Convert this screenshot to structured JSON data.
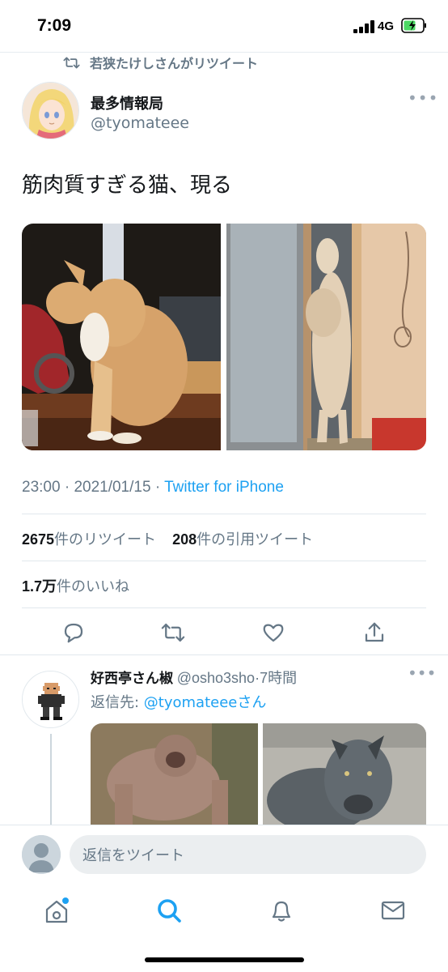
{
  "status_bar": {
    "time": "7:09",
    "network": "4G"
  },
  "retweet_context": {
    "text": "若狭たけしさんがリツイート",
    "icon": "retweet-icon"
  },
  "tweet": {
    "author_name": "最多情報局",
    "author_handle": "@tyomateee",
    "text": "筋肉質すぎる猫、現る",
    "time": "23:00",
    "date": "2021/01/15",
    "client": "Twitter for iPhone",
    "retweets_count": "2675",
    "retweets_label": "件のリツイート",
    "quotes_count": "208",
    "quotes_label": "件の引用ツイート",
    "likes_count": "1.7万",
    "likes_label": "件のいいね"
  },
  "actions": [
    "reply-icon",
    "retweet-icon",
    "like-icon",
    "share-icon"
  ],
  "reply": {
    "author_name": "好西亭さん椒",
    "author_handle": "@osho3sho",
    "time": "7時間",
    "reply_to_prefix": "返信先: ",
    "reply_to_handle": "@tyomateee",
    "reply_to_suffix": "さん"
  },
  "compose": {
    "placeholder": "返信をツイート"
  },
  "tab_bar": [
    "home-icon",
    "search-icon",
    "notifications-icon",
    "messages-icon"
  ],
  "colors": {
    "accent": "#1da1f2",
    "secondary_text": "#657786",
    "primary_text": "#14171a"
  }
}
